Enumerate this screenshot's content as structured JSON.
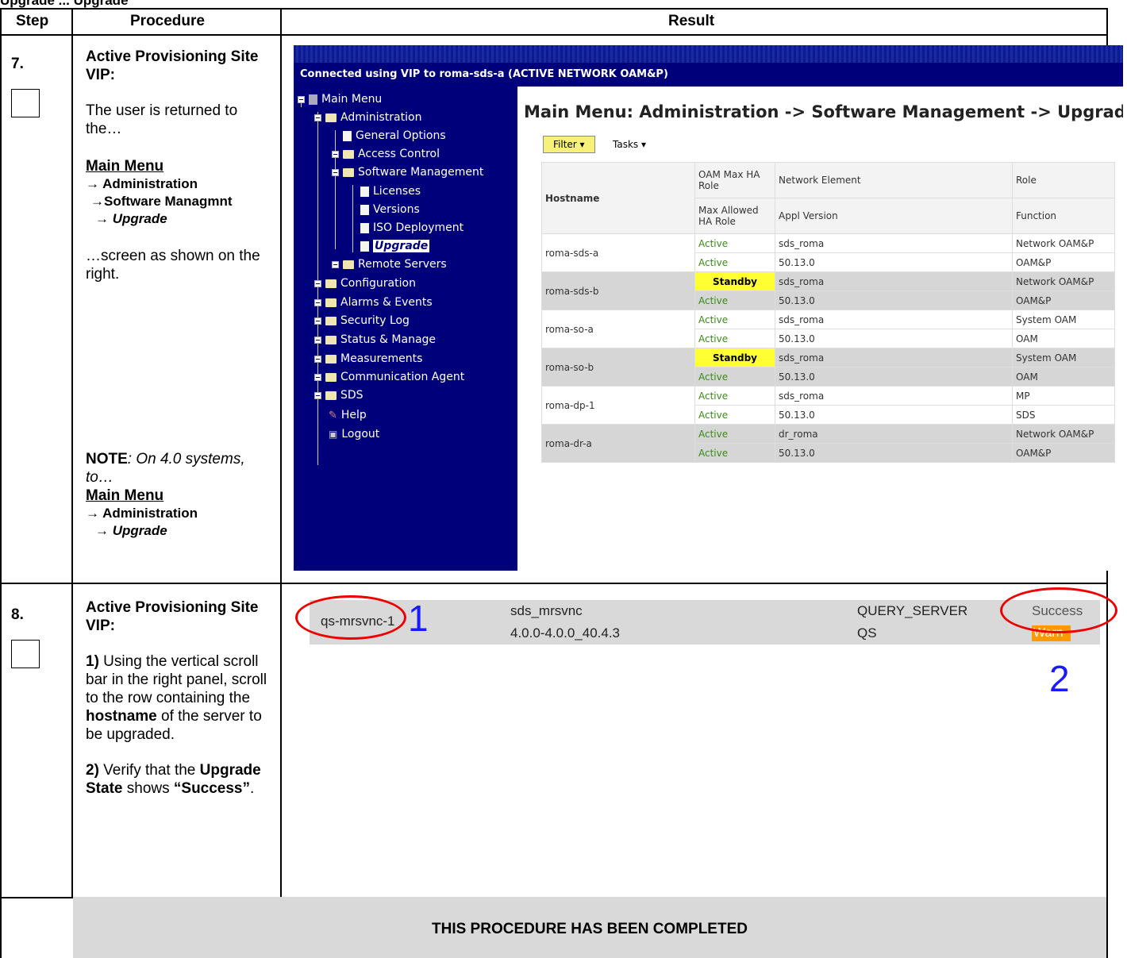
{
  "doc_header": "Upgrade ... Upgrade",
  "columns": {
    "step": "Step",
    "procedure": "Procedure",
    "result": "Result"
  },
  "step7": {
    "number": "7.",
    "title": "Active Provisioning Site VIP:",
    "text1": "The user is returned to the…",
    "menu_title": "Main Menu",
    "menu_l1": "→ Administration",
    "menu_l2": "→Software Managmnt",
    "menu_l3": "→ Upgrade",
    "text2": "…screen as shown on the right.",
    "note_label": "NOTE",
    "note_text": ": On 4.0 systems, to…",
    "note_menu_title": "Main Menu",
    "note_menu_l1": "→ Administration",
    "note_menu_l2": "→ Upgrade"
  },
  "gui": {
    "connection_text": "Connected using VIP to roma-sds-a (ACTIVE NETWORK OAM&P)",
    "page_title": "Main Menu: Administration -> Software Management -> Upgrade",
    "filter_label": "Filter",
    "tasks_label": "Tasks",
    "tree": [
      "Main Menu",
      "Administration",
      "General Options",
      "Access Control",
      "Software Management",
      "Licenses",
      "Versions",
      "ISO Deployment",
      "Upgrade",
      "Remote Servers",
      "Configuration",
      "Alarms & Events",
      "Security Log",
      "Status & Manage",
      "Measurements",
      "Communication Agent",
      "SDS",
      "Help",
      "Logout"
    ],
    "table_headers": {
      "hostname": "Hostname",
      "oam_max": "OAM Max HA Role",
      "max_allowed": "Max Allowed HA Role",
      "network_element": "Network Element",
      "appl_version": "Appl Version",
      "role": "Role",
      "function": "Function"
    },
    "rows": [
      {
        "host": "roma-sds-a",
        "ha1": "Active",
        "ha2": "Active",
        "ne": "sds_roma",
        "ver": "50.13.0",
        "role": "Network OAM&P",
        "func": "OAM&P"
      },
      {
        "host": "roma-sds-b",
        "ha1": "Standby",
        "ha2": "Active",
        "ne": "sds_roma",
        "ver": "50.13.0",
        "role": "Network OAM&P",
        "func": "OAM&P"
      },
      {
        "host": "roma-so-a",
        "ha1": "Active",
        "ha2": "Active",
        "ne": "sds_roma",
        "ver": "50.13.0",
        "role": "System OAM",
        "func": "OAM"
      },
      {
        "host": "roma-so-b",
        "ha1": "Standby",
        "ha2": "Active",
        "ne": "sds_roma",
        "ver": "50.13.0",
        "role": "System OAM",
        "func": "OAM"
      },
      {
        "host": "roma-dp-1",
        "ha1": "Active",
        "ha2": "Active",
        "ne": "sds_roma",
        "ver": "50.13.0",
        "role": "MP",
        "func": "SDS"
      },
      {
        "host": "roma-dr-a",
        "ha1": "Active",
        "ha2": "Active",
        "ne": "dr_roma",
        "ver": "50.13.0",
        "role": "Network OAM&P",
        "func": "OAM&P"
      }
    ]
  },
  "step8": {
    "number": "8.",
    "title": "Active Provisioning Site VIP:",
    "p1_num": "1)",
    "p1_a": " Using the vertical scroll bar in the right panel, scroll to the row containing the ",
    "p1_bold": "hostname",
    "p1_b": " of the server to be upgraded.",
    "p2_num": "2)",
    "p2_a": " Verify that the ",
    "p2_bold": "Upgrade State",
    "p2_b": " shows ",
    "p2_c": "“Success”",
    "p2_d": ".",
    "strip": {
      "host": "qs-mrsvnc-1",
      "ne": "sds_mrsvnc",
      "ver": "4.0.0-4.0.0_40.4.3",
      "role": "QUERY_SERVER",
      "func": "QS",
      "state": "Success",
      "status": "Warn"
    },
    "callout1": "1",
    "callout2": "2"
  },
  "footer": "THIS PROCEDURE HAS BEEN COMPLETED"
}
